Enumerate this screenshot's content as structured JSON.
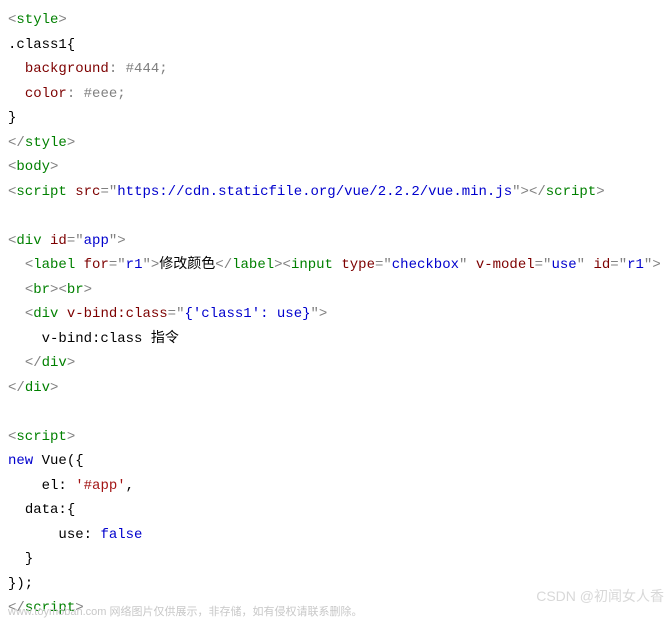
{
  "code": {
    "line1": {
      "tag_open": "<",
      "tag": "style",
      "tag_close": ">"
    },
    "line2": {
      "selector": ".class1{"
    },
    "line3": {
      "indent": "  ",
      "prop": "background",
      "colon": ": ",
      "val": "#444",
      ";": ";"
    },
    "line4": {
      "indent": "  ",
      "prop": "color",
      "colon": ": ",
      "val": "#eee",
      ";": ";"
    },
    "line5": {
      "brace": "}"
    },
    "line6": {
      "tag_open": "</",
      "tag": "style",
      "tag_close": ">"
    },
    "line7": {
      "tag_open": "<",
      "tag": "body",
      "tag_close": ">"
    },
    "line8": {
      "t1o": "<",
      "t1": "script",
      "sp1": " ",
      "a1": "src",
      "eq1": "=",
      "q1": "\"",
      "v1": "https://cdn.staticfile.org/vue/2.2.2/vue.min.js",
      "q2": "\"",
      "t1c": ">",
      "t2o": "</",
      "t2": "script",
      "t2c": ">"
    },
    "line10": {
      "t1o": "<",
      "t1": "div",
      "sp1": " ",
      "a1": "id",
      "eq1": "=",
      "q1": "\"",
      "v1": "app",
      "q2": "\"",
      "t1c": ">"
    },
    "line11": {
      "indent": "  ",
      "t1o": "<",
      "t1": "label",
      "sp1": " ",
      "a1": "for",
      "eq1": "=",
      "q1": "\"",
      "v1": "r1",
      "q2": "\"",
      "t1c": ">",
      "text1": "修改颜色",
      "t2o": "</",
      "t2": "label",
      "t2c": ">",
      "t3o": "<",
      "t3": "input",
      "sp3": " ",
      "a3": "type",
      "eq3": "=",
      "q3": "\"",
      "v3": "checkbox",
      "q4": "\"",
      "sp4": " ",
      "a4": "v-model",
      "eq4": "=",
      "q5": "\"",
      "v4": "use",
      "q6": "\"",
      "sp5": " ",
      "a5": "id",
      "eq5": "=",
      "q7": "\"",
      "v5": "r1",
      "q8": "\"",
      "t3c": ">"
    },
    "line12": {
      "indent": "  ",
      "t1o": "<",
      "t1": "br",
      "t1c": ">",
      "t2o": "<",
      "t2": "br",
      "t2c": ">"
    },
    "line13": {
      "indent": "  ",
      "t1o": "<",
      "t1": "div",
      "sp1": " ",
      "a1": "v-bind:class",
      "eq1": "=",
      "q1": "\"",
      "v1": "{'class1': use}",
      "q2": "\"",
      "t1c": ">"
    },
    "line14": {
      "indent": "    ",
      "text": "v-bind:class 指令"
    },
    "line15": {
      "indent": "  ",
      "t1o": "</",
      "t1": "div",
      "t1c": ">"
    },
    "line16": {
      "t1o": "</",
      "t1": "div",
      "t1c": ">"
    },
    "line18": {
      "t1o": "<",
      "t1": "script",
      "t1c": ">"
    },
    "line19": {
      "kw": "new",
      "sp": " ",
      "id": "Vue",
      "paren": "({"
    },
    "line20": {
      "indent": "    ",
      "prop": "el",
      "colon": ": ",
      "q1": "'",
      "val": "#app",
      "q2": "'",
      ",": ","
    },
    "line21": {
      "indent": "  ",
      "prop": "data",
      "colon": ":",
      "brace": "{"
    },
    "line22": {
      "indent": "      ",
      "prop": "use",
      "colon": ": ",
      "val": "false"
    },
    "line23": {
      "indent": "  ",
      "brace": "}"
    },
    "line24": {
      "close": "});"
    },
    "line25": {
      "t1o": "</",
      "t1": "script",
      "t1c": ">"
    }
  },
  "watermark_bl": "www.toymoban.com  网络图片仅供展示，非存储，如有侵权请联系删除。",
  "watermark_br": "CSDN @初闻女人香"
}
